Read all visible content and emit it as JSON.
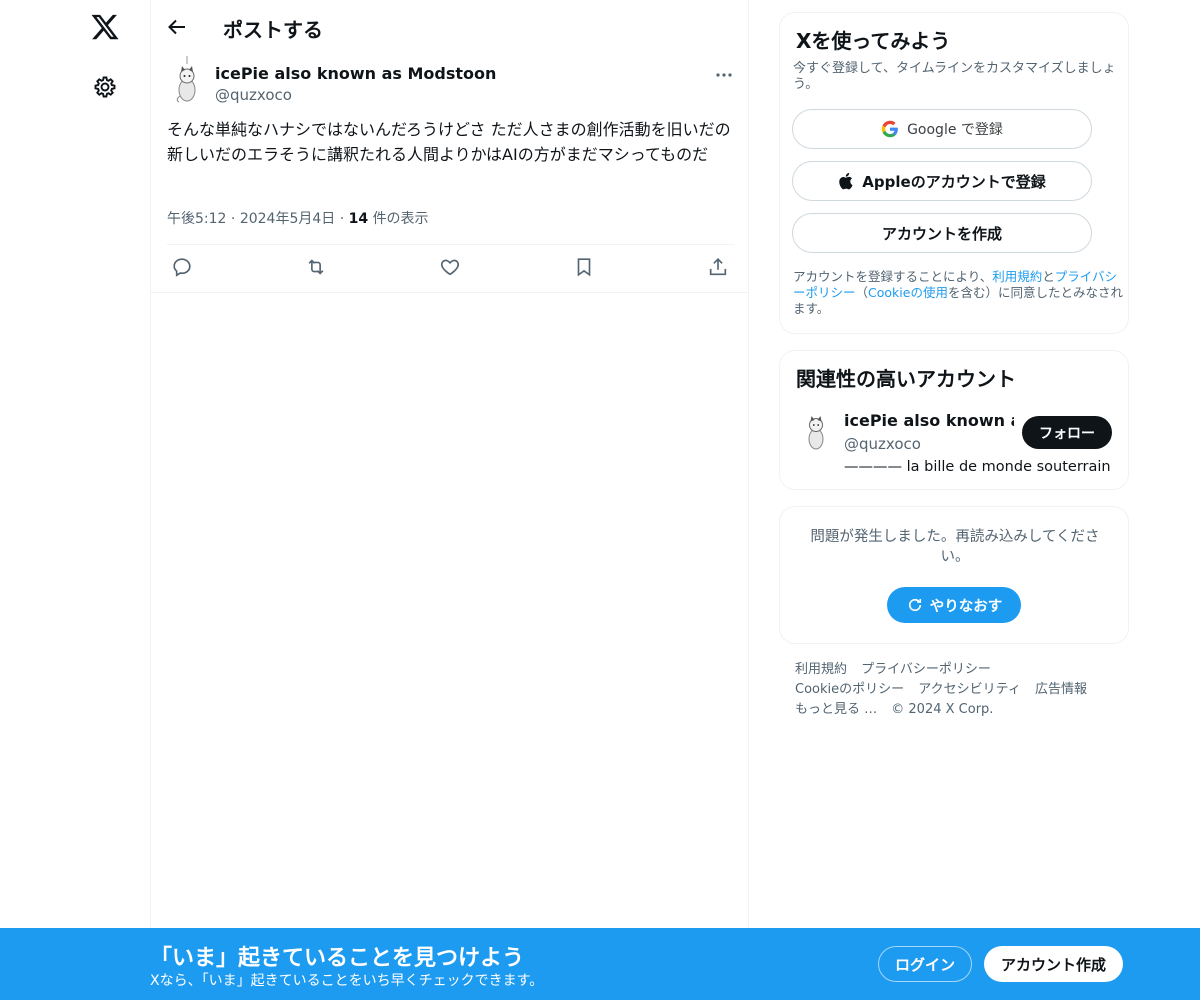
{
  "header": {
    "title": "ポストする"
  },
  "post": {
    "author_name": "icePie also known as Modstoon",
    "author_handle": "@quzxoco",
    "text": "そんな単純なハナシではないんだろうけどさ ただ人さまの創作活動を旧いだの新しいだのエラそうに講釈たれる人間よりかはAIの方がまだマシってものだ",
    "time": "午後5:12",
    "date": "2024年5月4日",
    "views_count": "14",
    "views_label": "件の表示",
    "dot": "·"
  },
  "signup_card": {
    "title": "Xを使ってみよう",
    "subtitle": "今すぐ登録して、タイムラインをカスタマイズしましょう。",
    "google_label": "Google で登録",
    "apple_label": "Appleのアカウントで登録",
    "create_label": "アカウントを作成",
    "legal_1": "アカウントを登録することにより、",
    "legal_terms": "利用規約",
    "legal_and": "と",
    "legal_privacy": "プライバシーポリシー",
    "legal_2": "（",
    "legal_cookie": "Cookieの使用",
    "legal_3": "を含む）に同意したとみなされます。"
  },
  "recommend_card": {
    "title": "関連性の高いアカウント",
    "name": "icePie also known as Modstoon",
    "handle": "@quzxoco",
    "bio": "———— la bille de monde souterrain",
    "follow_label": "フォロー"
  },
  "error_card": {
    "message": "問題が発生しました。再読み込みしてください。",
    "retry_label": "やりなおす"
  },
  "footer": {
    "terms": "利用規約",
    "privacy": "プライバシーポリシー",
    "cookie": "Cookieのポリシー",
    "accessibility": "アクセシビリティ",
    "ads": "広告情報",
    "more": "もっと見る …",
    "copyright": "© 2024 X Corp."
  },
  "bottom_bar": {
    "title": "「いま」起きていることを見つけよう",
    "subtitle": "Xなら、「いま」起きていることをいち早くチェックできます。",
    "login_label": "ログイン",
    "signup_label": "アカウント作成"
  },
  "colors": {
    "accent": "#1d9bf0",
    "text_primary": "#0f1419",
    "text_secondary": "#536471",
    "border": "#eff3f4"
  },
  "icons": {
    "logo": "x-logo-icon",
    "settings": "gear-icon",
    "back": "arrow-left-icon",
    "more": "more-dots-icon",
    "reply": "reply-icon",
    "repost": "repost-icon",
    "like": "heart-icon",
    "bookmark": "bookmark-icon",
    "share": "share-icon",
    "google": "google-icon",
    "apple": "apple-icon",
    "retry": "refresh-icon"
  }
}
